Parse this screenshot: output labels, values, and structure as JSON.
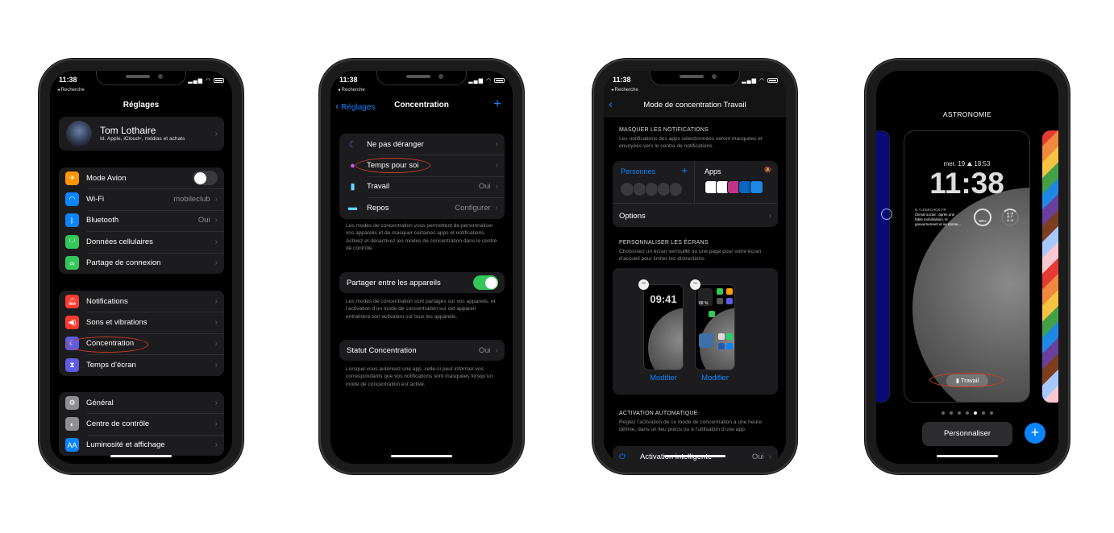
{
  "status": {
    "time": "11:38",
    "back": "◂ Recherche"
  },
  "phone1": {
    "title": "Réglages",
    "profile": {
      "name": "Tom  Lothaire",
      "subtitle": "Id. Apple, iCloud+, médias et achats"
    },
    "groups": [
      [
        {
          "label": "Mode Avion",
          "icon": "airplane-icon",
          "color": "#ff9500",
          "toggle": false
        },
        {
          "label": "Wi-Fi",
          "icon": "wifi-icon",
          "color": "#0a84ff",
          "value": "mobileclub"
        },
        {
          "label": "Bluetooth",
          "icon": "bluetooth-icon",
          "color": "#0a84ff",
          "value": "Oui"
        },
        {
          "label": "Données cellulaires",
          "icon": "antenna-icon",
          "color": "#34c759"
        },
        {
          "label": "Partage de connexion",
          "icon": "link-icon",
          "color": "#34c759"
        }
      ],
      [
        {
          "label": "Notifications",
          "icon": "bell-icon",
          "color": "#ff3b30"
        },
        {
          "label": "Sons et vibrations",
          "icon": "speaker-icon",
          "color": "#ff3b30"
        },
        {
          "label": "Concentration",
          "icon": "moon-icon",
          "color": "#5e5ce6"
        },
        {
          "label": "Temps d’écran",
          "icon": "hourglass-icon",
          "color": "#5e5ce6"
        }
      ],
      [
        {
          "label": "Général",
          "icon": "gear-icon",
          "color": "#8e8e93"
        },
        {
          "label": "Centre de contrôle",
          "icon": "switches-icon",
          "color": "#8e8e93"
        },
        {
          "label": "Luminosité et affichage",
          "icon": "text-size-icon",
          "color": "#0a84ff"
        }
      ]
    ]
  },
  "phone2": {
    "back": "Réglages",
    "title": "Concentration",
    "modes": [
      {
        "label": "Ne pas déranger",
        "icon": "moon-icon",
        "color": "#5e5ce6"
      },
      {
        "label": "Temps pour soi",
        "icon": "person-icon",
        "color": "#bf5af2"
      },
      {
        "label": "Travail",
        "icon": "badge-icon",
        "color": "#64d2ff",
        "value": "Oui"
      },
      {
        "label": "Repos",
        "icon": "bed-icon",
        "color": "#64d2ff",
        "value": "Configurer"
      }
    ],
    "modes_footer": "Les modes de concentration vous permettent de personnaliser vos appareils et de masquer certaines apps et notifications. Activez et désactivez les modes de concentration dans le centre de contrôle.",
    "share_label": "Partager entre les appareils",
    "share_on": true,
    "share_footer": "Les modes de concentration sont partagés sur vos appareils, et l’activation d’un mode de concentration sur cet appareil entraînera son activation sur tous les appareils.",
    "status_label": "Statut Concentration",
    "status_value": "Oui",
    "status_footer": "Lorsque vous autorisez une app, celle-ci peut informer vos correspondants que vos notifications sont masquées lorsqu’un mode de concentration est activé."
  },
  "phone3": {
    "title": "Mode de concentration Travail",
    "hide_header": "MASQUER LES NOTIFICATIONS",
    "hide_text": "Les notifications des apps sélectionnées seront masquées et envoyées vers le centre de notifications.",
    "people": "Personnes",
    "apps": "Apps",
    "options": "Options",
    "app_colors": [
      "#ffffff",
      "#ffffff",
      "#c13584",
      "#0a66c2",
      "#1e88e5"
    ],
    "screens_header": "PERSONNALISER LES ÉCRANS",
    "screens_text": "Choisissez un écran verrouillé ou une page pour votre écran d’accueil pour limiter les distractions.",
    "lock_time": "09:41",
    "home_battery": "88 %",
    "modify": "Modifier",
    "auto_header": "ACTIVATION AUTOMATIQUE",
    "auto_text": "Réglez l’activation de ce mode de concentration à une heure définie, dans un lieu précis ou à l’utilisation d’une app.",
    "smart_label": "Activation intelligente",
    "smart_value": "Oui"
  },
  "phone4": {
    "title": "ASTRONOMIE",
    "date": "mer. 19  ⛰ 18:53",
    "time": "11:38",
    "news_source": "N I LESECHOS.FR",
    "news_text": "Climat social : après une fable mobilisation, le gouvernement et se donne...",
    "battery": "88%",
    "temp": "17",
    "temp_range": "14  22",
    "focus_badge": "Travail",
    "page_count": 7,
    "page_active": 5,
    "customize": "Personnaliser"
  }
}
